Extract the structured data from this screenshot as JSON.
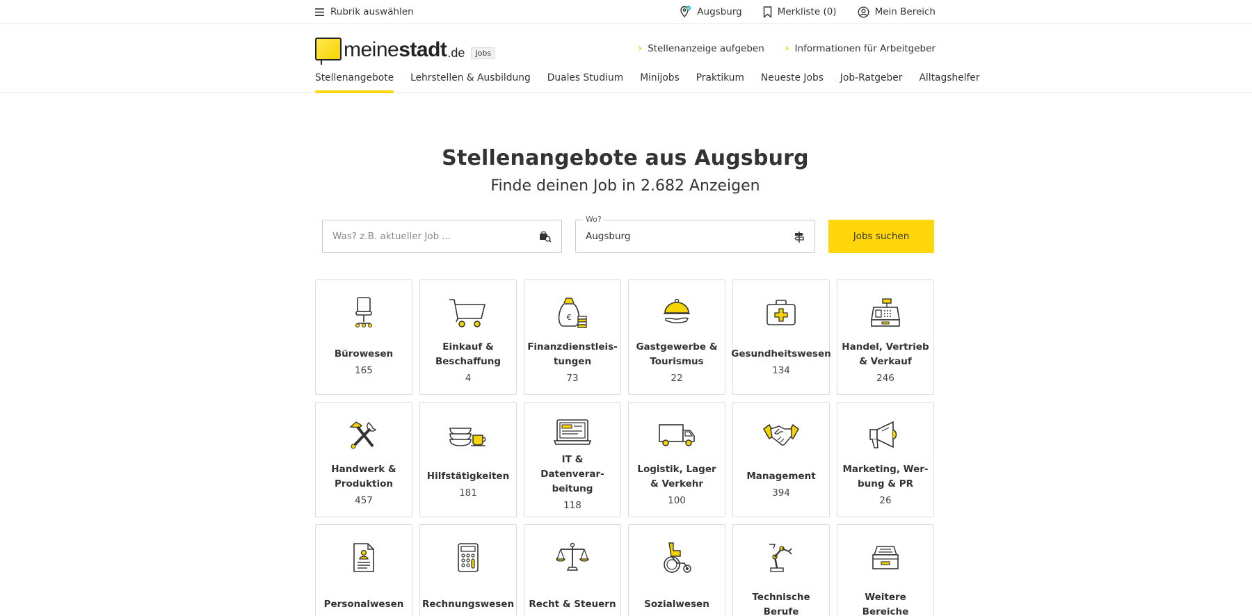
{
  "topbar": {
    "rubric_label": "Rubrik auswählen",
    "location_label": "Augsburg",
    "wishlist_label": "Merkliste (0)",
    "account_label": "Mein Bereich"
  },
  "header": {
    "logo_part1": "meine",
    "logo_part2": "stadt",
    "logo_tld": ".de",
    "logo_badge": "Jobs",
    "links": [
      "Stellenanzeige aufgeben",
      "Informationen für Arbeitgeber"
    ],
    "nav": [
      "Stellenangebote",
      "Lehrstellen & Ausbildung",
      "Duales Studium",
      "Minijobs",
      "Praktikum",
      "Neueste Jobs",
      "Job-Ratgeber",
      "Alltagshelfer"
    ],
    "active_nav": "Stellenangebote"
  },
  "hero": {
    "title": "Stellenangebote aus Augsburg",
    "subtitle": "Finde deinen Job in 2.682 Anzeigen"
  },
  "search": {
    "what_placeholder": "Was? z.B. aktueller Job ...",
    "where_label": "Wo?",
    "where_value": "Augsburg",
    "button_label": "Jobs suchen"
  },
  "categories": [
    {
      "name": "Bürowesen",
      "count": "165",
      "icon": "office-chair-icon"
    },
    {
      "name": "Einkauf & Beschaf­fung",
      "count": "4",
      "icon": "shopping-cart-icon"
    },
    {
      "name": "Finanzdienstleis­tungen",
      "count": "73",
      "icon": "money-bag-icon"
    },
    {
      "name": "Gastgewerbe & Tourismus",
      "count": "22",
      "icon": "cloche-icon"
    },
    {
      "name": "Gesundheitswesen",
      "count": "134",
      "icon": "first-aid-kit-icon"
    },
    {
      "name": "Handel, Vertrieb & Verkauf",
      "count": "246",
      "icon": "cash-register-icon"
    },
    {
      "name": "Handwerk & Pro­duktion",
      "count": "457",
      "icon": "tools-icon"
    },
    {
      "name": "Hilfstätigkeiten",
      "count": "181",
      "icon": "dishes-icon"
    },
    {
      "name": "IT & Datenverar­beitung",
      "count": "118",
      "icon": "laptop-icon"
    },
    {
      "name": "Logistik, Lager & Verkehr",
      "count": "100",
      "icon": "truck-icon"
    },
    {
      "name": "Management",
      "count": "394",
      "icon": "handshake-icon"
    },
    {
      "name": "Marketing, Wer­bung & PR",
      "count": "26",
      "icon": "megaphone-icon"
    },
    {
      "name": "Personalwesen",
      "count": "",
      "icon": "resume-icon"
    },
    {
      "name": "Rechnungswesen",
      "count": "",
      "icon": "calculator-icon"
    },
    {
      "name": "Recht & Steuern",
      "count": "",
      "icon": "scales-icon"
    },
    {
      "name": "Sozialwesen",
      "count": "",
      "icon": "wheelchair-icon"
    },
    {
      "name": "Technische Berufe",
      "count": "",
      "icon": "robot-arm-icon"
    },
    {
      "name": "Weitere Bereiche",
      "count": "",
      "icon": "inbox-tray-icon"
    }
  ],
  "colors": {
    "accent": "#ffd60a",
    "text": "#333333",
    "border": "#dcdcdc"
  }
}
